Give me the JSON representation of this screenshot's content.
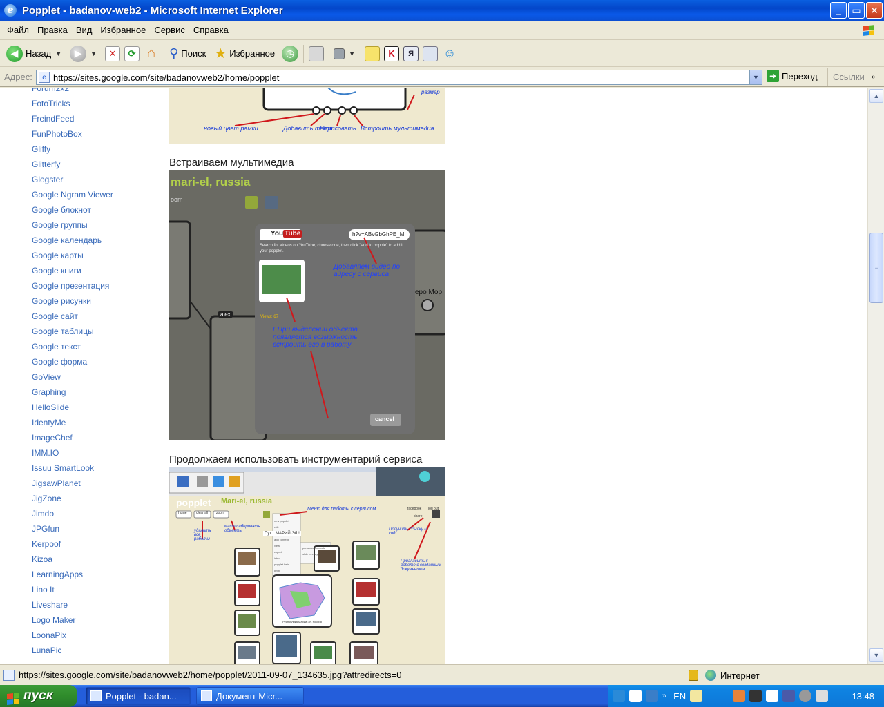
{
  "window": {
    "title": "Popplet - badanov-web2 - Microsoft Internet Explorer",
    "buttons": {
      "minimize": "_",
      "maximize": "▭",
      "close": "✕"
    }
  },
  "menu": [
    "Файл",
    "Правка",
    "Вид",
    "Избранное",
    "Сервис",
    "Справка"
  ],
  "toolbar": {
    "back_label": "Назад",
    "search_label": "Поиск",
    "favorites_label": "Избранное"
  },
  "address": {
    "label": "Адрес:",
    "url": "https://sites.google.com/site/badanovweb2/home/popplet",
    "go_label": "Переход",
    "links_label": "Ссылки"
  },
  "sidebar": {
    "items": [
      "Forum2x2",
      "FotoTricks",
      "FreindFeed",
      "FunPhotoBox",
      "Gliffy",
      "Glitterfy",
      "Glogster",
      "Google Ngram Viewer",
      "Google блокнот",
      "Google группы",
      "Google календарь",
      "Google карты",
      "Google книги",
      "Google презентация",
      "Google рисунки",
      "Google сайт",
      "Google таблицы",
      "Google текст",
      "Google форма",
      "GoView",
      "Graphing",
      "HelloSlide",
      "IdentyMe",
      "ImageChef",
      "IMM.IO",
      "Issuu SmartLook",
      "JigsawPlanet",
      "JigZone",
      "Jimdo",
      "JPGfun",
      "Kerpoof",
      "Kizoa",
      "LearningApps",
      "Lino It",
      "Liveshare",
      "Logo Maker",
      "LoonaPix",
      "LunaPic"
    ]
  },
  "main": {
    "caption_multimedia": "Встраиваем мультимедиа",
    "caption_tools": "Продолжаем использовать инструментарий сервиса",
    "shot1": {
      "labels": [
        "новый цвет рамки",
        "Добавить текст",
        "Нарисовать",
        "Встроить мультимедиа"
      ],
      "corner_label": "размер"
    },
    "shot2": {
      "popplet_title": "mari-el, russia",
      "zoom_label": "oom",
      "youtube_you": "You",
      "youtube_tube": "Tube",
      "search_value": "h?v=ABvGbGhPE_M",
      "instructions": "Search for videos on YouTube, choose one, then click \"add to popple\" to add it your popplet.",
      "views": "Views: 67",
      "note_add": "Добавляем видео по адресу с сервиса",
      "note_select": "ЕПри выделении объекта появляется возможность встроить его в работу",
      "cancel_label": "cancel",
      "user_tag": "alex",
      "side_text": "еро Мор"
    },
    "shot3": {
      "popplet_title": "Mari-el, russia",
      "center_text": "Республика Марий Эл, Россия",
      "node_text": "Пут... МАРИЙ ЭЛ !",
      "labels": [
        "Меню для работы с сервисом",
        "удалить все работы",
        "масштабировать объекты",
        "Получить ссылку и код",
        "Пригласить к работе с созданным документом"
      ],
      "buttons": [
        "home",
        "clear all",
        "zoom",
        "share",
        "facebook",
        "log out"
      ],
      "menu_items": [
        "new popplet",
        "edit",
        "organize",
        "add content",
        "view",
        "export",
        "intro",
        "popplet beta",
        "print",
        "presentation mode",
        "slide overlay"
      ]
    }
  },
  "status": {
    "url": "https://sites.google.com/site/badanovweb2/home/popplet/2011-09-07_134635.jpg?attredirects=0",
    "zone": "Интернет"
  },
  "taskbar": {
    "start_label": "пуск",
    "tasks": [
      "Popplet - badan...",
      "Документ Micr..."
    ],
    "lang": "EN",
    "clock": "13:48"
  },
  "colors": {
    "titlebar": "#0a59e8",
    "link": "#3769b9",
    "popplet_bg": "#efe9cf",
    "arrow_red": "#d0181c",
    "annotation_blue": "#1438d8"
  }
}
